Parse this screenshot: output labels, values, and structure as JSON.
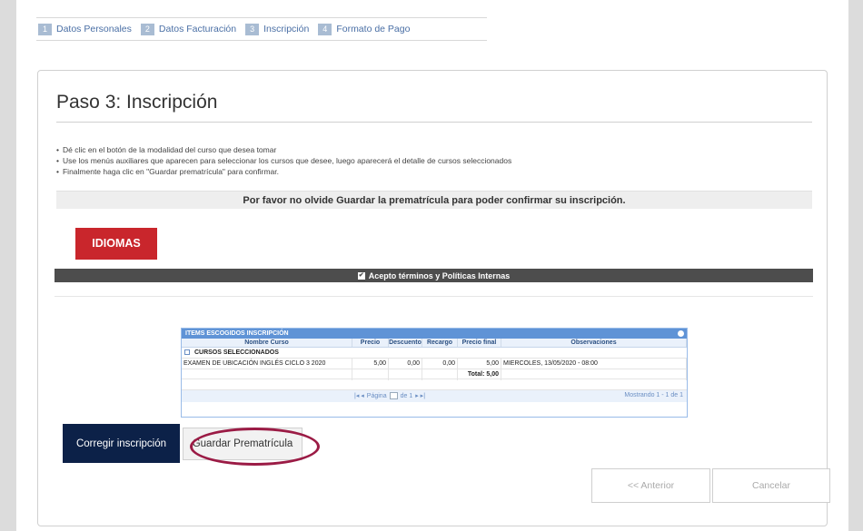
{
  "steps": [
    {
      "num": "1",
      "label": "Datos Personales"
    },
    {
      "num": "2",
      "label": "Datos Facturación"
    },
    {
      "num": "3",
      "label": "Inscripción"
    },
    {
      "num": "4",
      "label": "Formato de Pago"
    }
  ],
  "page": {
    "title": "Paso 3: Inscripción",
    "instructions": [
      "Dé clic en el botón de la modalidad del curso que desea tomar",
      "Use los menús auxiliares que aparecen para seleccionar los cursos que desee, luego aparecerá el detalle de cursos seleccionados",
      "Finalmente haga clic en \"Guardar prematrícula\" para confirmar."
    ],
    "notice": "Por favor no olvide Guardar la prematrícula para poder confirmar su inscripción."
  },
  "idiomas_button": "IDIOMAS",
  "terms_label": "Acepto términos y Políticas Internas",
  "grid": {
    "header": "ITEMS ESCOGIDOS INSCRIPCIÓN",
    "columns": [
      "Nombre Curso",
      "Precio",
      "Descuento",
      "Recargo",
      "Precio final",
      "Observaciones"
    ],
    "group_label": "CURSOS SELECCIONADOS",
    "rows": [
      {
        "curso": "EXAMEN DE UBICACIÓN INGLÉS CICLO 3 2020",
        "precio": "5,00",
        "descuento": "0,00",
        "recargo": "0,00",
        "final": "5,00",
        "obs": "MIERCOLES, 13/05/2020 - 08:00"
      }
    ],
    "total": "Total: 5,00",
    "pager": {
      "page_label": "Página",
      "page_value": "1",
      "of_label": "de 1",
      "status": "Mostrando 1 - 1 de 1"
    }
  },
  "buttons": {
    "corregir": "Corregir inscripción",
    "guardar": "Guardar Prematrícula",
    "anterior": "<< Anterior",
    "cancelar": "Cancelar"
  },
  "colors": {
    "idiomas": "#c9262c",
    "corregir": "#0c2148",
    "highlight_ring": "#9b1b45",
    "grid_header": "#5f93d6"
  }
}
